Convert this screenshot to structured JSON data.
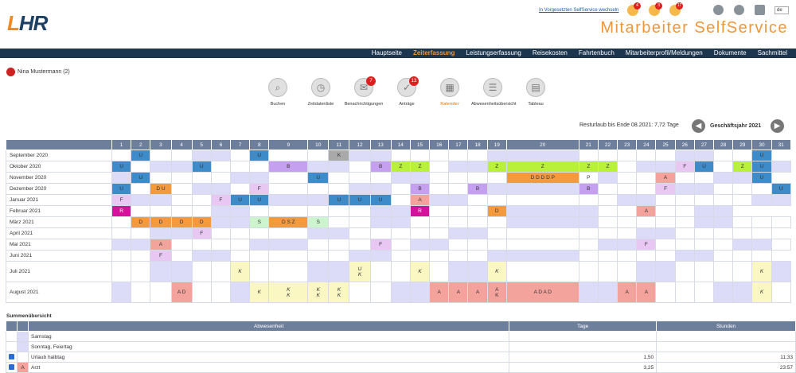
{
  "header": {
    "logo_l": "L",
    "logo_r": "HR",
    "switch_link": "In Vorgesetzten SelfService wechseln",
    "bell_counts": [
      "4",
      "3",
      "17"
    ],
    "lang": "de",
    "app_title": "Mitarbeiter SelfService"
  },
  "nav": [
    "Hauptseite",
    "Zeiterfassung",
    "Leistungserfassung",
    "Reisekosten",
    "Fahrtenbuch",
    "Mitarbeiterprofil/Meldungen",
    "Dokumente",
    "Sachmittel"
  ],
  "nav_active": 1,
  "user": {
    "name": "Nina Mustermann (2)"
  },
  "toolbar": [
    {
      "label": "Buchen",
      "icon": "clock-search-icon",
      "badge": ""
    },
    {
      "label": "Zeitdatenliste",
      "icon": "clock-icon",
      "badge": ""
    },
    {
      "label": "Benachrichtigungen",
      "icon": "bell-icon",
      "badge": "7"
    },
    {
      "label": "Anträge",
      "icon": "checklist-icon",
      "badge": "13"
    },
    {
      "label": "Kalender",
      "icon": "calendar-icon",
      "badge": "",
      "active": true
    },
    {
      "label": "Abwesenheitsübersicht",
      "icon": "absence-overview-icon",
      "badge": ""
    },
    {
      "label": "Tableau",
      "icon": "tableau-icon",
      "badge": ""
    }
  ],
  "rest_text": "Resturlaub bis Ende 08.2021: 7,72 Tage",
  "fiscal_year": "Geschäftsjahr 2021",
  "colors": {
    "we": "#dcdcf8",
    "U": "#3d8bc8",
    "K": "#a9a9a9",
    "B": "#c59ff0",
    "Z": "#b8f03a",
    "D": "#f49a3c",
    "P": "#ffffff",
    "A": "#f4a39c",
    "F": "#e8c8f2",
    "R": "#d6119c",
    "S": "#cdf5cd",
    "V": "#fbf7c2"
  },
  "calendar": {
    "days": [
      "1",
      "2",
      "3",
      "4",
      "5",
      "6",
      "7",
      "8",
      "9",
      "10",
      "11",
      "12",
      "13",
      "14",
      "15",
      "16",
      "17",
      "18",
      "19",
      "20",
      "21",
      "22",
      "23",
      "24",
      "25",
      "26",
      "27",
      "28",
      "29",
      "30",
      "31"
    ],
    "months": [
      {
        "name": "September 2020",
        "lines": 1,
        "we": [
          5,
          6,
          12,
          13,
          19,
          20,
          26,
          27
        ],
        "cells": {
          "2": [
            "U",
            "U"
          ],
          "8": [
            "U",
            "U"
          ],
          "11": [
            "K",
            "K"
          ],
          "30": [
            "U",
            "U"
          ]
        },
        "hide": [
          31
        ]
      },
      {
        "name": "Oktober 2020",
        "lines": 1,
        "we": [
          3,
          4,
          10,
          11,
          17,
          18,
          24,
          25,
          31
        ],
        "cells": {
          "1": [
            "U",
            "U"
          ],
          "5": [
            "U",
            "U"
          ],
          "9": [
            "B",
            "B"
          ],
          "13": [
            "B",
            "B"
          ],
          "14": [
            "Z",
            "Z"
          ],
          "15": [
            "Z",
            "Z"
          ],
          "19": [
            "Z",
            "Z"
          ],
          "20": [
            "Z",
            "Z"
          ],
          "21": [
            "Z",
            "Z"
          ],
          "22": [
            "Z",
            "Z"
          ],
          "26": [
            "F",
            "F"
          ],
          "27": [
            "U",
            "U"
          ],
          "29": [
            "Z",
            "Z"
          ],
          "30": [
            "U",
            "U"
          ]
        }
      },
      {
        "name": "November 2020",
        "lines": 1,
        "we": [
          1,
          7,
          8,
          14,
          15,
          21,
          22,
          28,
          29
        ],
        "cells": {
          "2": [
            "U",
            "U"
          ],
          "10": [
            "U",
            "U"
          ],
          "20": [
            "D D D D P",
            "D"
          ],
          "21": [
            "P",
            "P"
          ],
          "25": [
            "A",
            "A"
          ],
          "30": [
            "U",
            "U"
          ]
        },
        "hide": [
          31
        ]
      },
      {
        "name": "Dezember 2020",
        "lines": 1,
        "we": [
          5,
          6,
          12,
          13,
          19,
          20,
          26,
          27
        ],
        "cells": {
          "1": [
            "U",
            "U"
          ],
          "3": [
            "D U",
            "D"
          ],
          "8": [
            "F",
            "F"
          ],
          "15": [
            "B",
            "B"
          ],
          "18": [
            "B",
            "B"
          ],
          "21": [
            "B",
            "B"
          ],
          "25": [
            "F",
            "F"
          ],
          "31": [
            "U",
            "U"
          ]
        }
      },
      {
        "name": "Januar 2021",
        "lines": 1,
        "we": [
          2,
          3,
          9,
          10,
          16,
          17,
          23,
          24,
          30,
          31
        ],
        "cells": {
          "1": [
            "F",
            "F"
          ],
          "6": [
            "F",
            "F"
          ],
          "7": [
            "U",
            "U"
          ],
          "8": [
            "U",
            "U"
          ],
          "11": [
            "U",
            "U"
          ],
          "12": [
            "U",
            "U"
          ],
          "13": [
            "U",
            "U"
          ],
          "15": [
            "A",
            "A"
          ]
        }
      },
      {
        "name": "Februar 2021",
        "lines": 1,
        "we": [
          6,
          7,
          13,
          14,
          20,
          21,
          27,
          28
        ],
        "cells": {
          "1": [
            "R",
            "R"
          ],
          "15": [
            "R",
            "R"
          ],
          "19": [
            "D",
            "D"
          ],
          "24": [
            "A",
            "A"
          ]
        },
        "hide": [
          29,
          30,
          31
        ]
      },
      {
        "name": "März 2021",
        "lines": 1,
        "we": [
          6,
          7,
          13,
          14,
          20,
          21,
          27,
          28
        ],
        "cells": {
          "2": [
            "D",
            "D"
          ],
          "3": [
            "D",
            "D"
          ],
          "4": [
            "D",
            "D"
          ],
          "5": [
            "D",
            "D"
          ],
          "8": [
            "S",
            "S"
          ],
          "9": [
            "D S Z",
            "D"
          ],
          "10": [
            "S",
            "S"
          ]
        }
      },
      {
        "name": "April 2021",
        "lines": 1,
        "we": [
          3,
          4,
          10,
          11,
          17,
          18,
          24,
          25
        ],
        "cells": {
          "5": [
            "F",
            "F"
          ]
        },
        "hide": [
          31
        ]
      },
      {
        "name": "Mai 2021",
        "lines": 1,
        "we": [
          1,
          2,
          8,
          9,
          15,
          16,
          22,
          23,
          29,
          30
        ],
        "cells": {
          "3": [
            "A",
            "A"
          ],
          "13": [
            "F",
            "F"
          ],
          "24": [
            "F",
            "F"
          ]
        }
      },
      {
        "name": "Juni 2021",
        "lines": 1,
        "we": [
          5,
          6,
          12,
          13,
          19,
          20,
          26,
          27
        ],
        "cells": {
          "3": [
            "F",
            "F"
          ]
        },
        "hide": [
          31
        ]
      },
      {
        "name": "Juli 2021",
        "lines": 2,
        "we": [
          3,
          4,
          10,
          11,
          17,
          18,
          24,
          25,
          31
        ],
        "cells": {
          "7": [
            "K",
            "V"
          ],
          "12": [
            "U\nK",
            "V"
          ],
          "15": [
            "K",
            "V"
          ],
          "19": [
            "K",
            "V"
          ],
          "30": [
            "K",
            "V"
          ]
        }
      },
      {
        "name": "August 2021",
        "lines": 2,
        "we": [
          1,
          7,
          8,
          14,
          15,
          21,
          22,
          28,
          29
        ],
        "cells": {
          "4": [
            "A D",
            "A"
          ],
          "8": [
            "K",
            "V"
          ],
          "9": [
            "K\nK",
            "V"
          ],
          "10": [
            "K\nK",
            "V"
          ],
          "11": [
            "K\nK",
            "V"
          ],
          "16": [
            "A",
            "A"
          ],
          "17": [
            "A",
            "A"
          ],
          "18": [
            "A",
            "A"
          ],
          "19": [
            "A\nK",
            "A"
          ],
          "20": [
            "A D A D",
            "A"
          ],
          "23": [
            "A",
            "A"
          ],
          "24": [
            "A",
            "A"
          ],
          "30": [
            "K",
            "V"
          ]
        }
      }
    ]
  },
  "summary": {
    "title": "Summenübersicht",
    "headers": [
      "Abwesenheit",
      "Tage",
      "Stunden"
    ],
    "rows": [
      {
        "check": false,
        "code": "",
        "color": "we",
        "label": "Samstag",
        "tage": "",
        "stunden": ""
      },
      {
        "check": false,
        "code": "",
        "color": "we",
        "label": "Sonntag, Feiertag",
        "tage": "",
        "stunden": ""
      },
      {
        "check": true,
        "code": "",
        "color": "P",
        "label": "Urlaub halbtag",
        "tage": "1,50",
        "stunden": "11:33"
      },
      {
        "check": true,
        "code": "A",
        "color": "A",
        "label": "Arzt",
        "tage": "3,25",
        "stunden": "23:57"
      }
    ]
  }
}
